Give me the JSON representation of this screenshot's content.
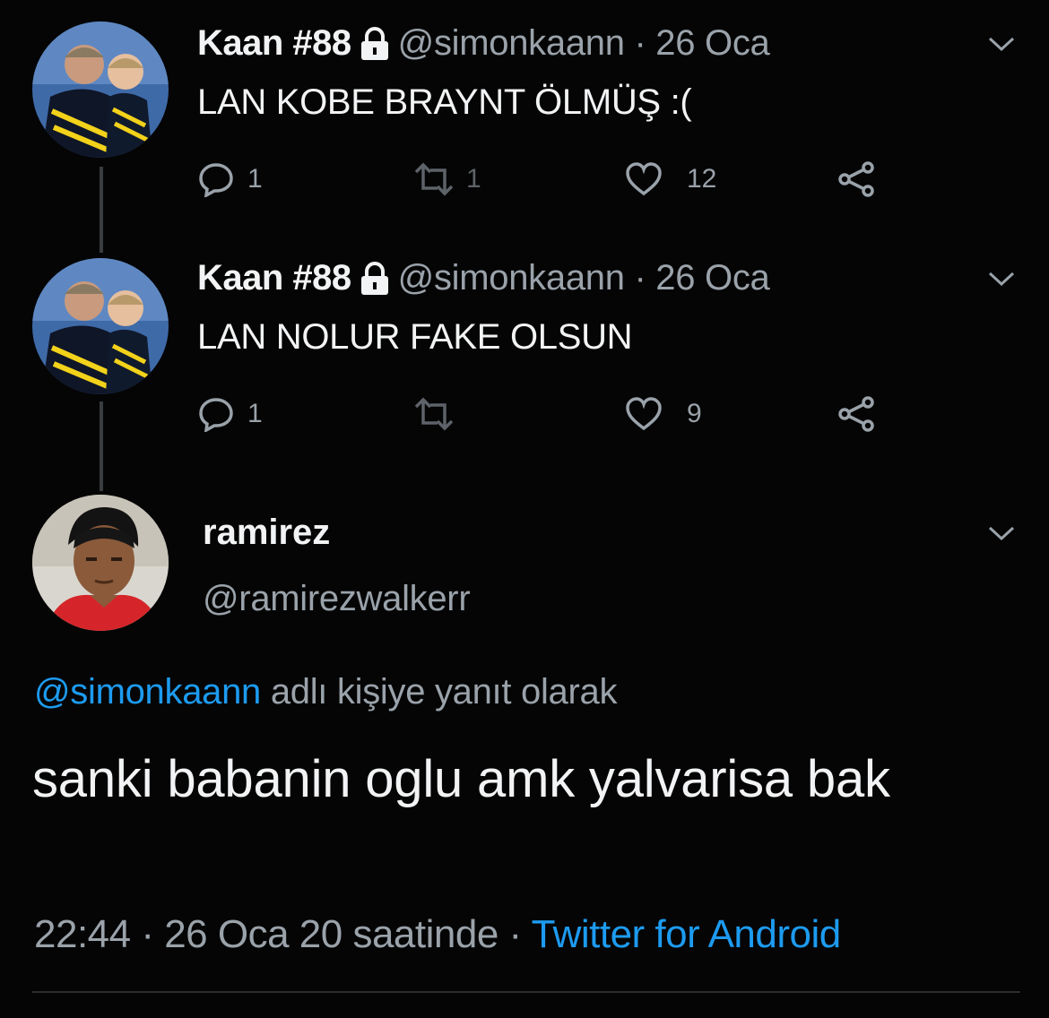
{
  "tweets": [
    {
      "name": "Kaan #88",
      "handle_date": "@simonkaann · 26 Oca",
      "text": "LAN KOBE BRAYNT ÖLMÜŞ :(",
      "replies": "1",
      "retweets": "1",
      "likes": "12"
    },
    {
      "name": "Kaan #88",
      "handle_date": "@simonkaann · 26 Oca",
      "text": "LAN NOLUR FAKE OLSUN",
      "replies": "1",
      "retweets": "",
      "likes": "9"
    }
  ],
  "main_tweet": {
    "name": "ramirez",
    "handle": "@ramirezwalkerr",
    "reply_mention": "@simonkaann",
    "reply_suffix": "adlı kişiye yanıt olarak",
    "text": "sanki babanin oglu amk yalvarisa bak",
    "time": "22:44 · 26 Oca 20 saatinde · ",
    "source": "Twitter for Android"
  },
  "colors": {
    "background": "#050505",
    "primary_text": "#f2f3f4",
    "secondary_text": "#9aa2aa",
    "link": "#1d9bf0",
    "thread_line": "#3a3d40"
  },
  "icons": [
    "lock-icon",
    "reply-icon",
    "retweet-icon",
    "like-icon",
    "share-icon",
    "chevron-down-icon"
  ]
}
